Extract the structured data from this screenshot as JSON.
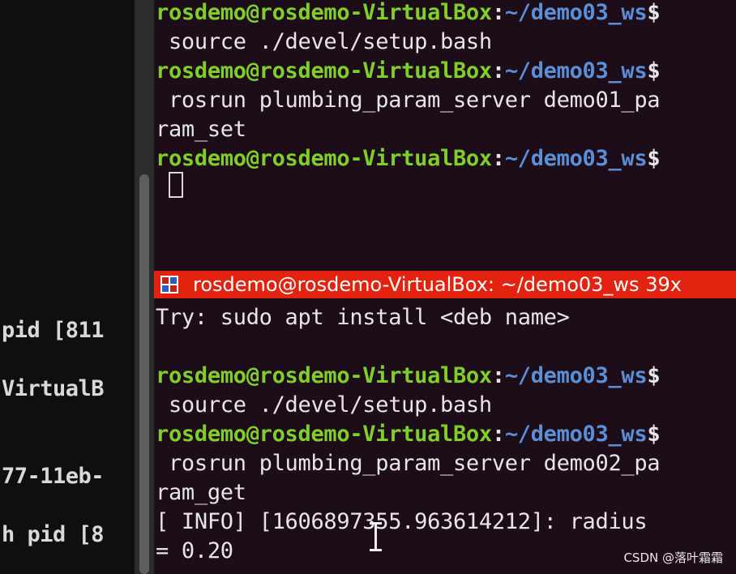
{
  "left_pane": {
    "lines": [
      "pid [811",
      "VirtualB",
      "77-11eb-",
      "h pid [8"
    ]
  },
  "prompt": {
    "user_host": "rosdemo@rosdemo-VirtualBox",
    "separator": ":",
    "path": "~/demo03_ws",
    "dollar": "$"
  },
  "top_terminal": {
    "line2": " source ./devel/setup.bash",
    "line4": " rosrun plumbing_param_server demo01_pa",
    "line5": "ram_set"
  },
  "bottom_terminal": {
    "window_title": "rosdemo@rosdemo-VirtualBox: ~/demo03_ws 39x",
    "line1": "Try: sudo apt install <deb name>",
    "line4": " source ./devel/setup.bash",
    "line6": " rosrun plumbing_param_server demo02_pa",
    "line7": "ram_get",
    "line8": "[ INFO] [1606897355.963614212]: radius",
    "line9": "= 0.20"
  },
  "watermark": "CSDN @落叶霜霜",
  "colors": {
    "terminal_bg": "#1d0d18",
    "prompt_user": "#7fce2a",
    "prompt_path": "#5a8fd8",
    "titlebar": "#e3230f"
  }
}
